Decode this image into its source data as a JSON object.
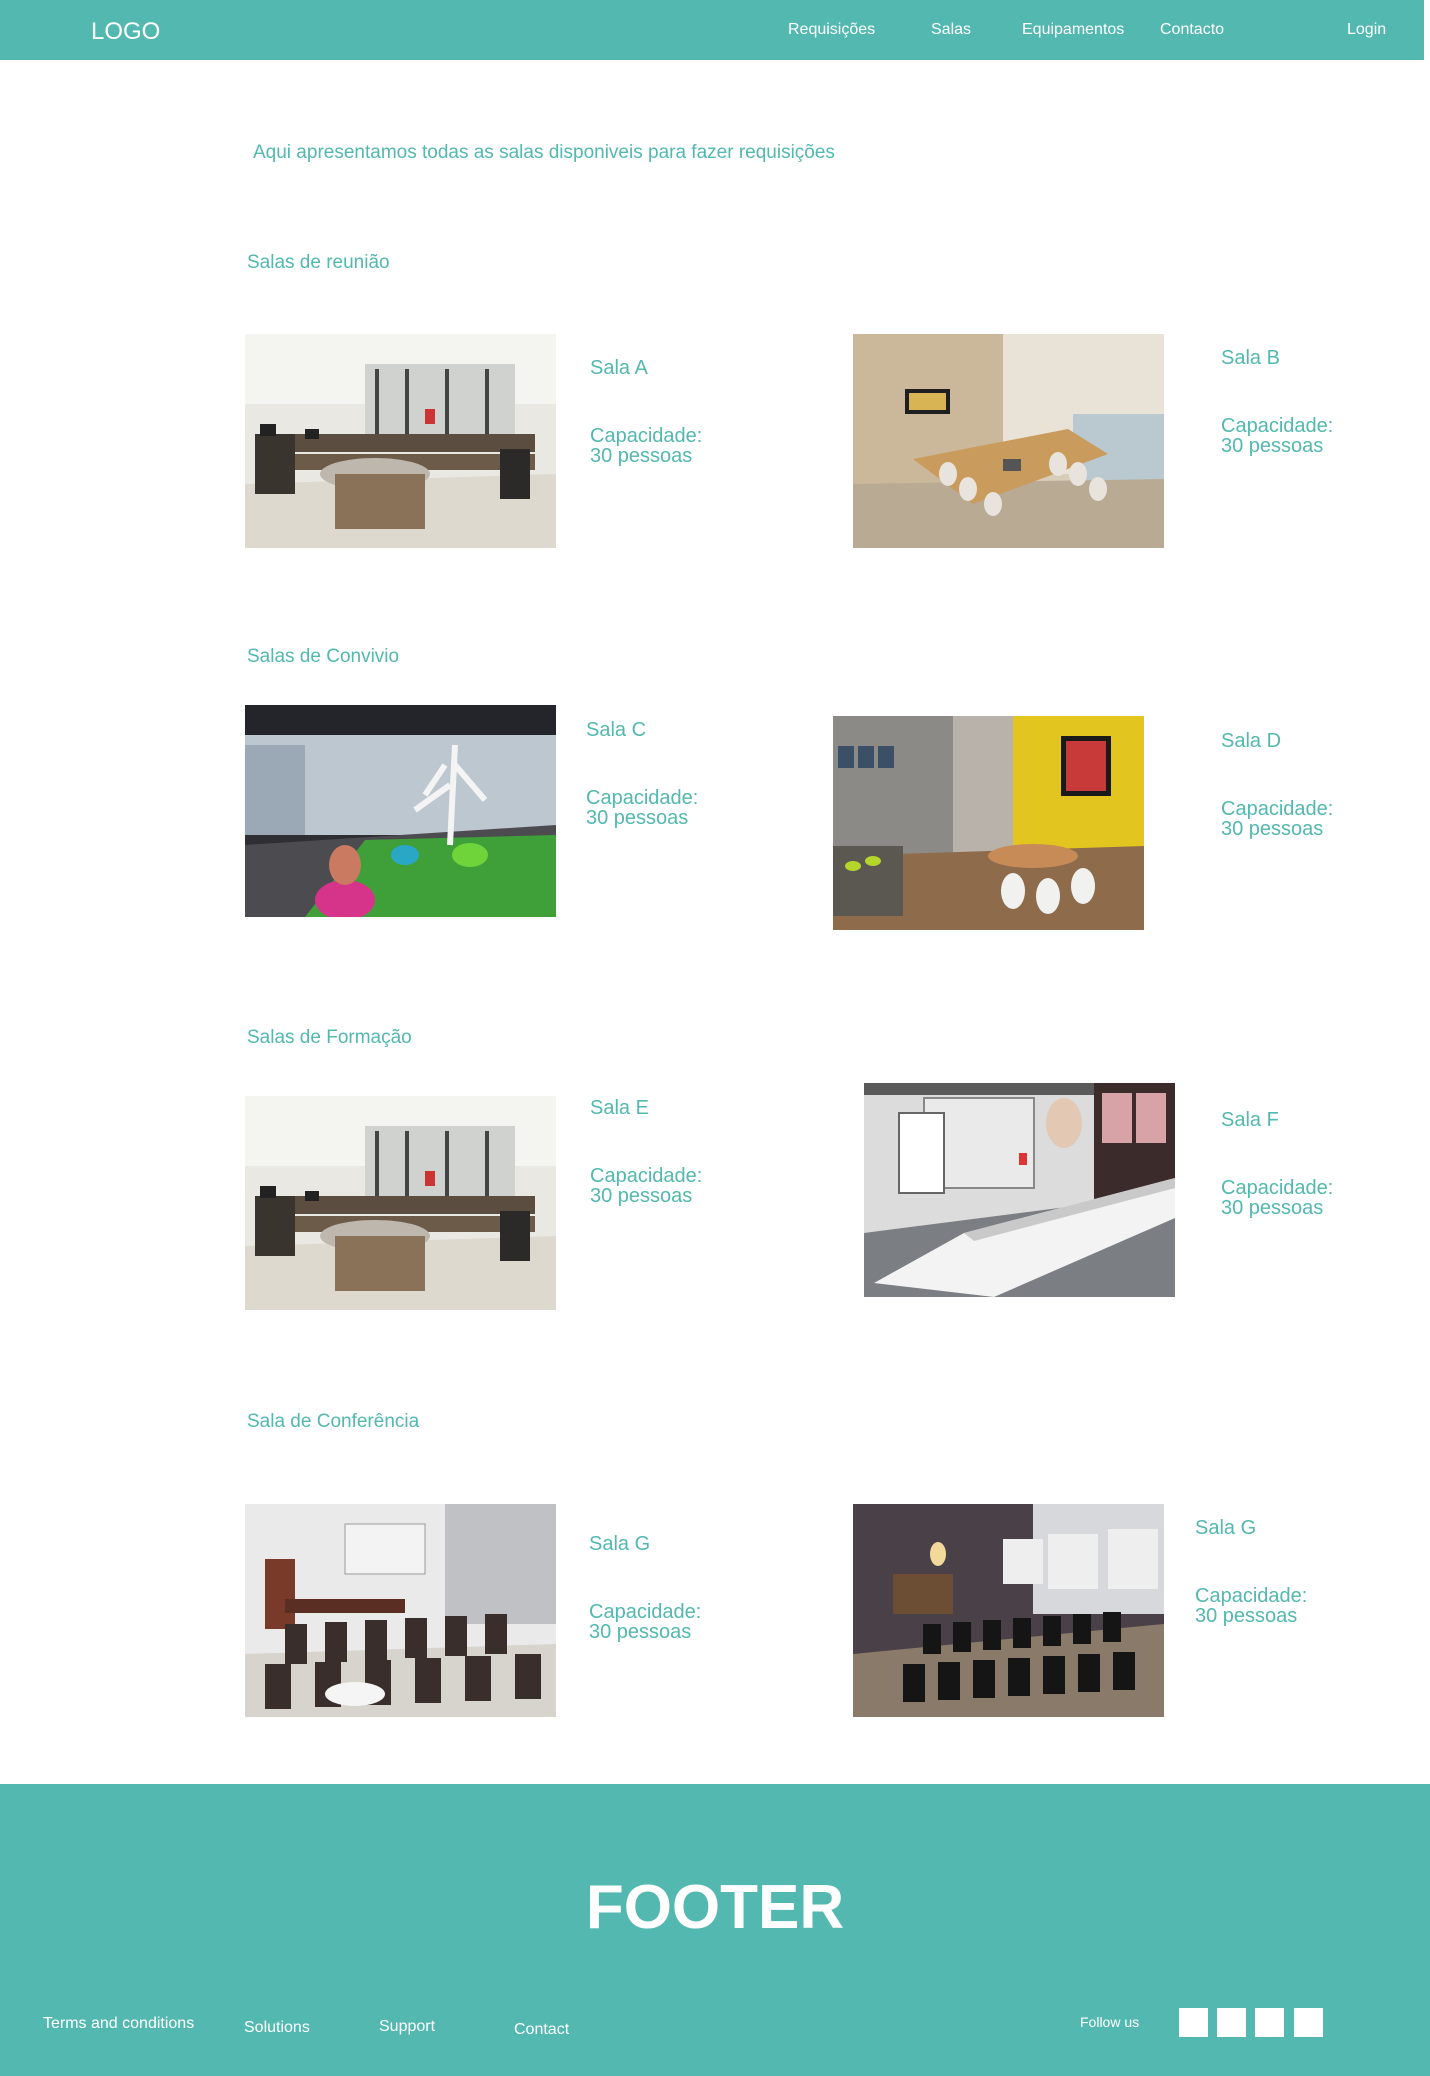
{
  "header": {
    "logo": "LOGO",
    "nav": [
      "Requisições",
      "Salas",
      "Equipamentos",
      "Contacto"
    ],
    "login": "Login",
    "bg_color": "#52b8b0"
  },
  "intro": "Aqui apresentamos todas as  salas disponiveis para fazer requisições",
  "sections": [
    {
      "title": "Salas de reunião",
      "rooms": [
        {
          "name": "Sala A",
          "capacity_label": "Capacidade:",
          "capacity_value": "30 pessoas",
          "image": "office-room"
        },
        {
          "name": "Sala B",
          "capacity_label": "Capacidade:",
          "capacity_value": "30 pessoas",
          "image": "meeting-room"
        }
      ]
    },
    {
      "title": "Salas de Convivio",
      "rooms": [
        {
          "name": "Sala C",
          "capacity_label": "Capacidade:",
          "capacity_value": "30 pessoas",
          "image": "lounge-grass"
        },
        {
          "name": "Sala D",
          "capacity_label": "Capacidade:",
          "capacity_value": "30 pessoas",
          "image": "lounge-sofa"
        }
      ]
    },
    {
      "title": "Salas de Formação",
      "rooms": [
        {
          "name": "Sala E",
          "capacity_label": "Capacidade:",
          "capacity_value": "30 pessoas",
          "image": "office-room"
        },
        {
          "name": "Sala F",
          "capacity_label": "Capacidade:",
          "capacity_value": "30 pessoas",
          "image": "training-room"
        }
      ]
    },
    {
      "title": "Sala de Conferência",
      "rooms": [
        {
          "name": "Sala G",
          "capacity_label": "Capacidade:",
          "capacity_value": "30 pessoas",
          "image": "classroom"
        },
        {
          "name": "Sala G",
          "capacity_label": "Capacidade:",
          "capacity_value": "30 pessoas",
          "image": "conference-room"
        }
      ]
    }
  ],
  "footer": {
    "title": "FOOTER",
    "links": [
      "Terms and conditions",
      "Solutions",
      "Support",
      "Contact"
    ],
    "follow_label": "Follow us",
    "social_count": 4
  }
}
